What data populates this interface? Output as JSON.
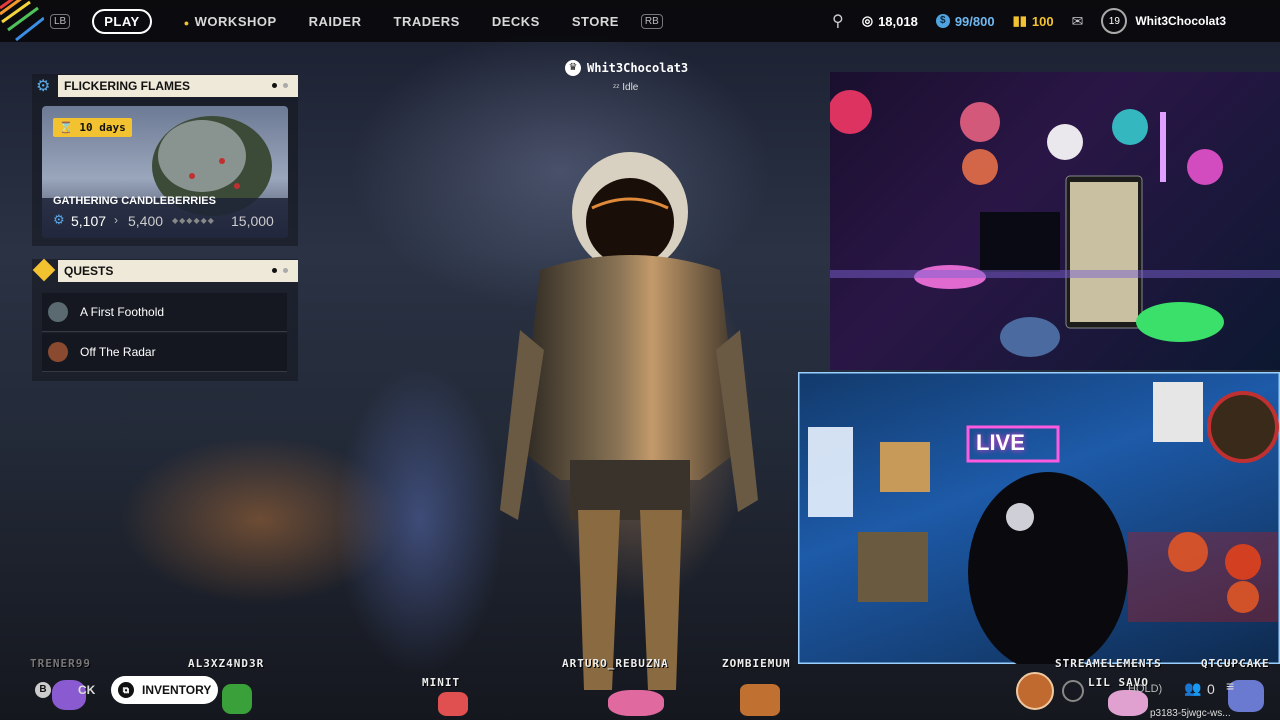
{
  "topbar": {
    "lb": "LB",
    "rb": "RB",
    "nav": [
      "PLAY",
      "WORKSHOP",
      "RAIDER",
      "TRADERS",
      "DECKS",
      "STORE"
    ],
    "currency1": "18,018",
    "currency2": "99/800",
    "currency3": "100",
    "level": "19",
    "username": "Whit3Chocolat3"
  },
  "event": {
    "title": "FLICKERING FLAMES",
    "timer": "10 days",
    "name": "GATHERING CANDLEBERRIES",
    "current": "5,107",
    "next": "5,400",
    "max": "15,000"
  },
  "quests": {
    "title": "QUESTS",
    "items": [
      "A First Foothold",
      "Off The Radar"
    ]
  },
  "player": {
    "name": "Whit3Chocolat3",
    "status": "Idle"
  },
  "overlay": {
    "names": [
      "TRENER99",
      "AL3XZ4ND3R",
      "MINIT",
      "ARTURO_REBUZNA",
      "ZOMBIEMUM",
      "STREAMELEMENTS",
      "QTCUPCAKE",
      "LIL SAVO"
    ],
    "live_sign": "LIVE",
    "stream_code": "p3183-5jwgc-ws..."
  },
  "bottom": {
    "back_key": "B",
    "back_label": "CK",
    "inventory": "INVENTORY",
    "hold_label": "HOLD)",
    "party_count": "0"
  },
  "colors": {
    "accent_cream": "#efe9d9",
    "timer_yellow": "#f2c230",
    "quest_icon_yellow": "#f2c230"
  }
}
